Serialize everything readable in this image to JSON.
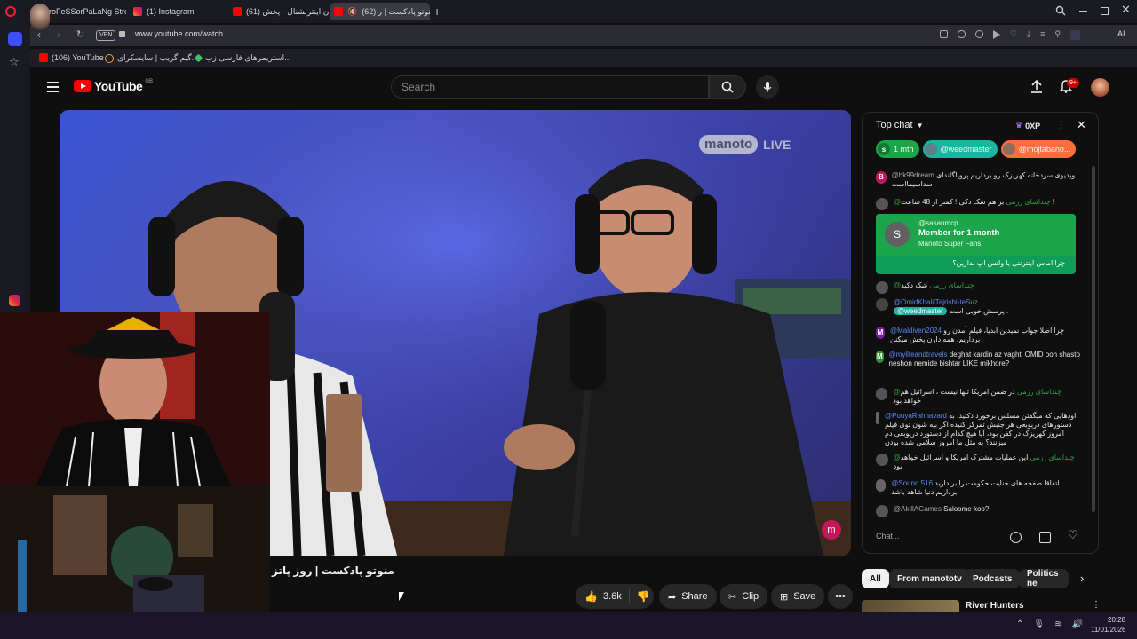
{
  "browser": {
    "tabs": [
      {
        "label": "ProFeSSorPaLaNg Stream",
        "color": "#e14a3a"
      },
      {
        "label": "(1) Instagram",
        "color": "#d6249f"
      },
      {
        "label": "(61) ایران اینترنشنال - پخش",
        "color": "#ff0000"
      },
      {
        "label": "(62) منوتو پادکست | ر...",
        "color": "#ff0000"
      }
    ],
    "vpn_label": "VPN",
    "url": "www.youtube.com/watch",
    "ai_label": "AI",
    "bookmarks": [
      {
        "label": "(106) YouTube",
        "color": "#ff0000"
      },
      {
        "label": "گیم گریپ | سایسکرای...",
        "color": "#f0a030"
      },
      {
        "label": "استریمرهای فارسی زب...",
        "color": "#3cbf6a"
      }
    ]
  },
  "youtube": {
    "logo_text": "YouTube",
    "region": "GB",
    "search_placeholder": "Search",
    "notification_count": "9+"
  },
  "video": {
    "brand_logo": "manoto",
    "live_badge": "LIVE",
    "title": "منوتو پادکست | روز پاتز",
    "likes": "3.6k",
    "share_label": "Share",
    "clip_label": "Clip",
    "save_label": "Save"
  },
  "chat": {
    "header_title": "Top chat",
    "points": "0XP",
    "pinned": [
      {
        "label": "1 mth",
        "initial": "s"
      },
      {
        "label": "@weedmaster"
      },
      {
        "label": "@mojtabano..."
      }
    ],
    "messages": [
      {
        "initial": "B",
        "color": "#c2185b",
        "author": "@bk99dream",
        "text": "ویدیوی سردخانه کهریزک رو برداریم پروپاگاندای سداسیمااست"
      },
      {
        "initial": "",
        "color": "#555",
        "author": "@چنداسای رزمی",
        "text": "بر هم شک دکی ! کمتر از 48 ساعت !"
      },
      {
        "initial": "",
        "color": "#555",
        "author": "@چنداسای رزمی",
        "text": "شک دکید"
      },
      {
        "initial": "",
        "color": "#444",
        "author": "@OmidKhalilTajrishi-teSuz",
        "text": "پرسش خوبی است .",
        "mention": "@weedmaster"
      },
      {
        "initial": "M",
        "color": "#7b1fa2",
        "author": "@Maldiven2024",
        "text": "چرا اصلا جواب نمیدین ابدیا، فیلم آمدن رو برداریم، همه دارن پخش میکنن"
      },
      {
        "initial": "M",
        "color": "#388e3c",
        "author": "@mylifeandtravels",
        "text": "deghat kardin az vaghti OMID oon shasto neshon nemide bishtar LIKE mikhore?"
      },
      {
        "initial": "",
        "color": "#555",
        "author": "@چنداسای رزمی",
        "text": "در ضمن امریکا تنها نیست ، اسرائیل هم خواهد بود"
      },
      {
        "initial": "",
        "color": "#666",
        "author": "@PouyaRahnavard",
        "text": "اودهایی که میگفتن مسلس برخورد دکتید، به دستورهای دریوبعی هر جنبش تمرکز کنیده اگر بیه شون توی فیلم امروز کهریزک در کفن بود، آیا هیچ کدام از دستورد دریوبعی دم میزنند؟ به مثل ما امروز سلامی شده بودن"
      },
      {
        "initial": "",
        "color": "#555",
        "author": "@چنداسای رزمی",
        "text": "این عملیات مشترک امریکا و اسرائیل خواهد بود"
      },
      {
        "initial": "",
        "color": "#666",
        "author": "@Sound.516",
        "text": "اتفاقا صفحه های جنایت حکومت را بر دارید برداریم دنیا شاهد باشد"
      },
      {
        "initial": "",
        "color": "#555",
        "author": "@AkillAGames",
        "text": "Saloome koo?"
      }
    ],
    "membership": {
      "initial": "S",
      "author": "@sasanmcp",
      "title": "Member for 1 month",
      "subtitle": "Manoto Super Fans",
      "message": "چرا اماس اینترنتی یا واتس اپ ندارین؟"
    },
    "input_placeholder": "Chat..."
  },
  "filters": [
    "All",
    "From manototv",
    "Podcasts",
    "Politics ne"
  ],
  "recommendation_title": "River Hunters",
  "taskbar": {
    "time": "20:28",
    "date": "11/01/2026"
  }
}
